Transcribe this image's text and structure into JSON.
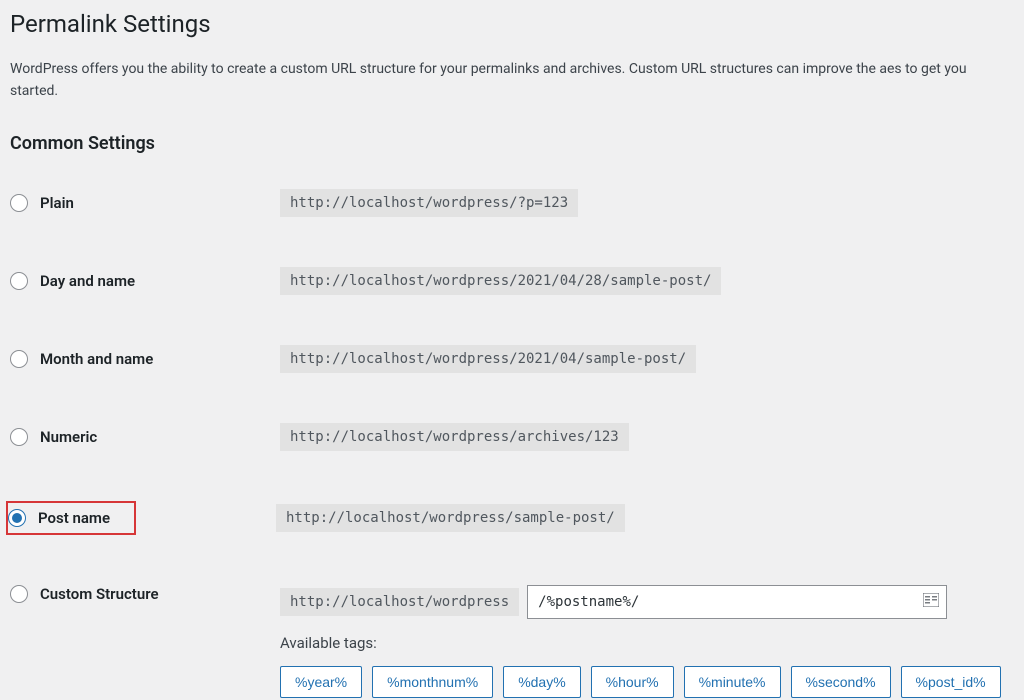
{
  "title": "Permalink Settings",
  "description": "WordPress offers you the ability to create a custom URL structure for your permalinks and archives. Custom URL structures can improve the aes to get you started.",
  "subheading": "Common Settings",
  "options": {
    "plain": {
      "label": "Plain",
      "url": "http://localhost/wordpress/?p=123"
    },
    "day_name": {
      "label": "Day and name",
      "url": "http://localhost/wordpress/2021/04/28/sample-post/"
    },
    "month_name": {
      "label": "Month and name",
      "url": "http://localhost/wordpress/2021/04/sample-post/"
    },
    "numeric": {
      "label": "Numeric",
      "url": "http://localhost/wordpress/archives/123"
    },
    "post_name": {
      "label": "Post name",
      "url": "http://localhost/wordpress/sample-post/"
    },
    "custom": {
      "label": "Custom Structure",
      "prefix": "http://localhost/wordpress",
      "value": "/%postname%/"
    }
  },
  "available_tags_label": "Available tags:",
  "tags": [
    "%year%",
    "%monthnum%",
    "%day%",
    "%hour%",
    "%minute%",
    "%second%",
    "%post_id%"
  ]
}
